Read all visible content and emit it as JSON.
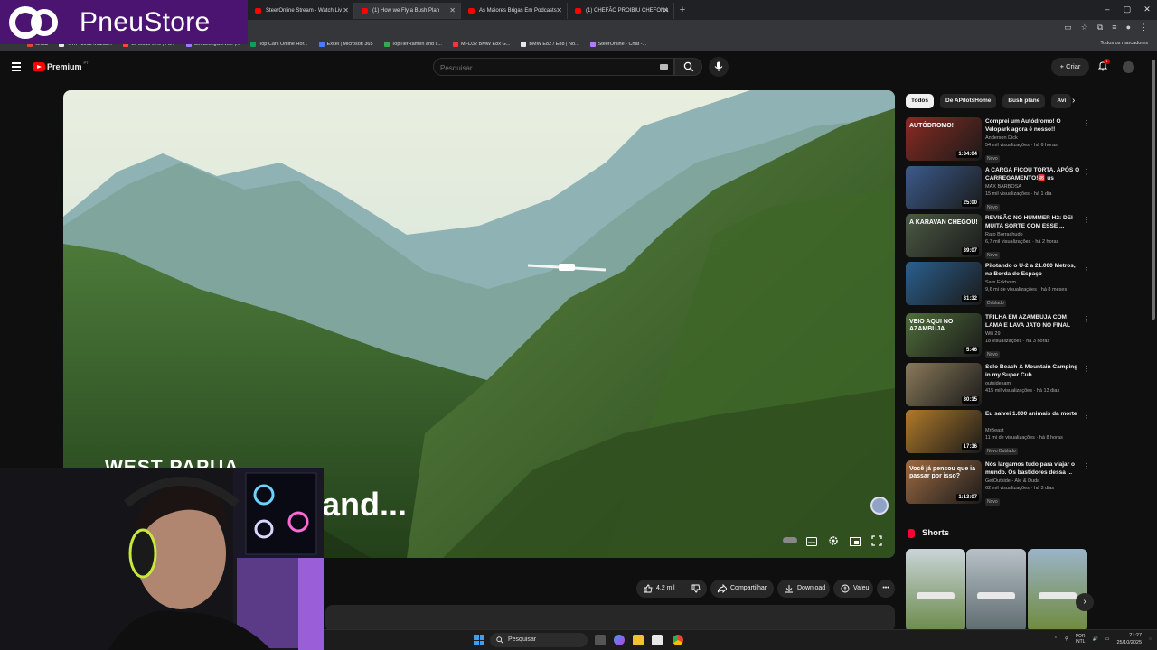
{
  "browser": {
    "tabs": [
      {
        "label": "SteerOnline Stream - Watch Liv",
        "active": false
      },
      {
        "label": "(1) How we Fly a Bush Plan",
        "active": true,
        "audio": true
      },
      {
        "label": "As Maiores Brigas Em Podcasts",
        "active": false
      },
      {
        "label": "(1) CHEFÃO PROIBIU CHEFONA",
        "active": false
      }
    ],
    "new_tab": "+",
    "window_controls": [
      "–",
      "▢",
      "✕"
    ],
    "bookmarks": [
      "Gmail",
      "TATP-3003 Mazda...",
      "Ls Mods v2.0 | Fu...",
      "StreamingService |...",
      "Top Cars Online Hor...",
      "Excel | Microsoft 365",
      "TopTierRamen and s...",
      "MFD32 BMW E8x G...",
      "BMW E82 / E88 | No...",
      "SteerOnline - Chat -..."
    ],
    "bookmarks_folder": "Todos os marcadores"
  },
  "brand": {
    "name": "PneuStore",
    "color": "#4a1470"
  },
  "youtube": {
    "logo_label": "Premium",
    "country": "PT",
    "search_placeholder": "Pesquisar",
    "create_label": "Criar",
    "notification_count": "1"
  },
  "video": {
    "overlay_title": "WEST PAPUA",
    "overlay_subtitle": "and..."
  },
  "actions": {
    "likes": "4,2 mil",
    "share": "Compartilhar",
    "download": "Download",
    "thanks": "Valeu"
  },
  "chips": [
    "Todos",
    "De APilotsHome",
    "Bush plane",
    "Avi"
  ],
  "recommendations": [
    {
      "title": "Comprei um Autódromo! O Velopark agora é nosso!!",
      "channel": "Anderson Dick",
      "views": "54 mil visualizações",
      "age": "há 6 horas",
      "duration": "1:34:04",
      "badge": "Novo",
      "thumb_color": "#8a2b22",
      "thumb_text": "AUTÓDROMO!"
    },
    {
      "title": "A CARGA FICOU TORTA, APÓS O CARREGAMENTO!🆘 us",
      "channel": "MAX BARBOSA",
      "views": "15 mil visualizações",
      "age": "há 1 dia",
      "duration": "25:00",
      "badge": "Novo",
      "thumb_color": "#3c5b8c",
      "thumb_text": ""
    },
    {
      "title": "REVISÃO NO HUMMER H2: DEI MUITA SORTE COM ESSE ...",
      "channel": "Rato Borrachudo",
      "views": "6,7 mil visualizações",
      "age": "há 2 horas",
      "duration": "39:07",
      "badge": "Novo",
      "thumb_color": "#4b5b44",
      "thumb_text": "A KARAVAN CHEGOU!"
    },
    {
      "title": "Pilotando o U-2 a 21.000 Metros, na Borda do Espaço",
      "channel": "Sam Eckholm",
      "views": "9,6 mi de visualizações",
      "age": "há 8 meses",
      "duration": "31:32",
      "badge": "Dublado",
      "thumb_color": "#2b5f8e",
      "thumb_text": ""
    },
    {
      "title": "TRILHA EM AZAMBUJA COM LAMA E LAVA JATO NO FINAL",
      "channel": "Wili 29",
      "views": "18 visualizações",
      "age": "há 3 horas",
      "duration": "5:46",
      "badge": "Novo",
      "thumb_color": "#4f6e3a",
      "thumb_text": "VEIO AQUI NO AZAMBUJA"
    },
    {
      "title": "Solo Beach & Mountain Camping in my Super Cub",
      "channel": "outsidesam",
      "views": "415 mil visualizações",
      "age": "há 13 dias",
      "duration": "30:15",
      "badge": "",
      "thumb_color": "#8a7a5a",
      "thumb_text": ""
    },
    {
      "title": "Eu salvei 1.000 animais da morte",
      "channel": "MrBeast",
      "views": "11 mi de visualizações",
      "age": "há 8 horas",
      "duration": "17:36",
      "badge": "Novo  Dublado",
      "thumb_color": "#b07a2a",
      "thumb_text": ""
    },
    {
      "title": "Nós largamos tudo para viajar o mundo. Os bastidores dessa ...",
      "channel": "GetOutside - Ale & Duda",
      "views": "62 mil visualizações",
      "age": "há 3 dias",
      "duration": "1:13:07",
      "badge": "Novo",
      "thumb_color": "#9c6a42",
      "thumb_text": "Você já pensou que ia passar por isso?"
    }
  ],
  "shorts": {
    "label": "Shorts",
    "items": [
      {
        "color_top": "#c9d4d8",
        "color_bottom": "#6b8a4a"
      },
      {
        "color_top": "#b7c1c7",
        "color_bottom": "#5d6a6e"
      },
      {
        "color_top": "#9bb4c8",
        "color_bottom": "#6f8a3c"
      }
    ]
  },
  "taskbar": {
    "search_placeholder": "Pesquisar",
    "language": "POR",
    "layout": "INTL",
    "time": "21:27",
    "date": "25/10/2025"
  }
}
